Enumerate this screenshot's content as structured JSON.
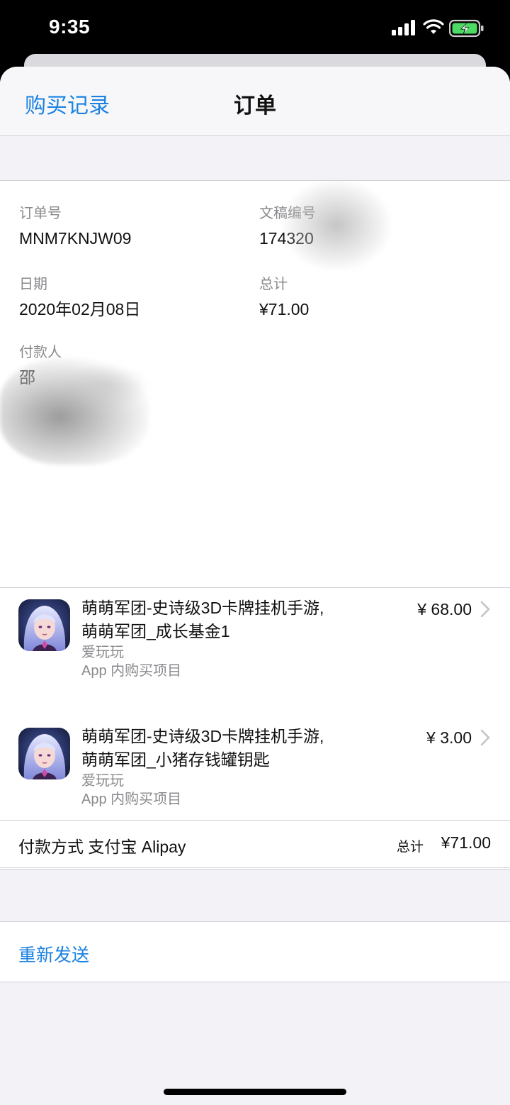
{
  "status_bar": {
    "time": "9:35"
  },
  "nav": {
    "back_label": "购买记录",
    "title": "订单"
  },
  "order_info": {
    "order_number_label": "订单号",
    "order_number": "MNM7KNJW09",
    "document_label": "文稿编号",
    "document_number": "174320",
    "date_label": "日期",
    "date": "2020年02月08日",
    "total_label": "总计",
    "total": "¥71.00",
    "payer_label": "付款人",
    "payer_name": "邵"
  },
  "items": [
    {
      "title": "萌萌军团-史诗级3D卡牌挂机手游, 萌萌军团_成长基金1",
      "developer": "爱玩玩",
      "type": "App 内购买项目",
      "price": "¥ 68.00"
    },
    {
      "title": "萌萌军团-史诗级3D卡牌挂机手游, 萌萌军团_小猪存钱罐钥匙",
      "developer": "爱玩玩",
      "type": "App 内购买项目",
      "price": "¥ 3.00"
    }
  ],
  "payment": {
    "method_label": "付款方式 支付宝 Alipay",
    "total_label": "总计",
    "total": "¥71.00"
  },
  "actions": {
    "resend_label": "重新发送"
  },
  "colors": {
    "accent": "#1a82e2",
    "background": "#f2f2f7",
    "battery": "#4cd964"
  },
  "icons": [
    "signal-icon",
    "wifi-icon",
    "battery-charging-icon",
    "chevron-right-icon",
    "app-icon"
  ]
}
